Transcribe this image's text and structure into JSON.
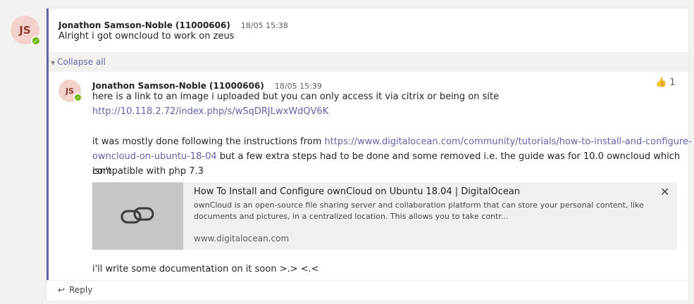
{
  "root_message": {
    "avatar_initials": "JS",
    "author": "Jonathon Samson-Noble (11000606)",
    "timestamp": "18/05 15:38",
    "text": "Alright i got owncloud to work on zeus"
  },
  "collapse": {
    "label": "Collapse all",
    "icon": "chevron-down-icon"
  },
  "reply_message": {
    "avatar_initials": "JS",
    "author": "Jonathon Samson-Noble (11000606)",
    "timestamp": "18/05 15:39",
    "reaction": {
      "icon": "thumbs-up-icon",
      "count": "1"
    },
    "line1": "here is a link to an image i uploaded but you can only access it via citrix or being on site",
    "link1": "http://10.118.2.72/index.php/s/wSqDRJLwxWdQV6K",
    "para2_prefix": "it was mostly done following the instructions from ",
    "link2_part1": "https://www.digitalocean.com/community/tutorials/how-to-install-and-configure-",
    "link2_part2": "owncloud-on-ubuntu-18-04",
    "para2_suffix1": " but a few extra steps had to be done and some removed i.e. the guide was for 10.0 owncloud which isn't",
    "para2_suffix2": "compatible with php 7.3",
    "closing": "i'll write some documentation on it soon >.> <.<"
  },
  "link_preview": {
    "icon": "link-icon",
    "title": "How To Install and Configure ownCloud on Ubuntu 18.04 | DigitalOcean",
    "description": "ownCloud is an open-source file sharing server and collaboration platform that can store your personal content, like documents and pictures, in a centralized location. This allows you to take contr...",
    "domain": "www.digitalocean.com"
  },
  "reply_button": {
    "label": "Reply",
    "icon": "reply-arrow-icon"
  },
  "colors": {
    "accent": "#6264a7",
    "presence": "#6bb700",
    "avatar_bg": "#f4d2cc"
  }
}
